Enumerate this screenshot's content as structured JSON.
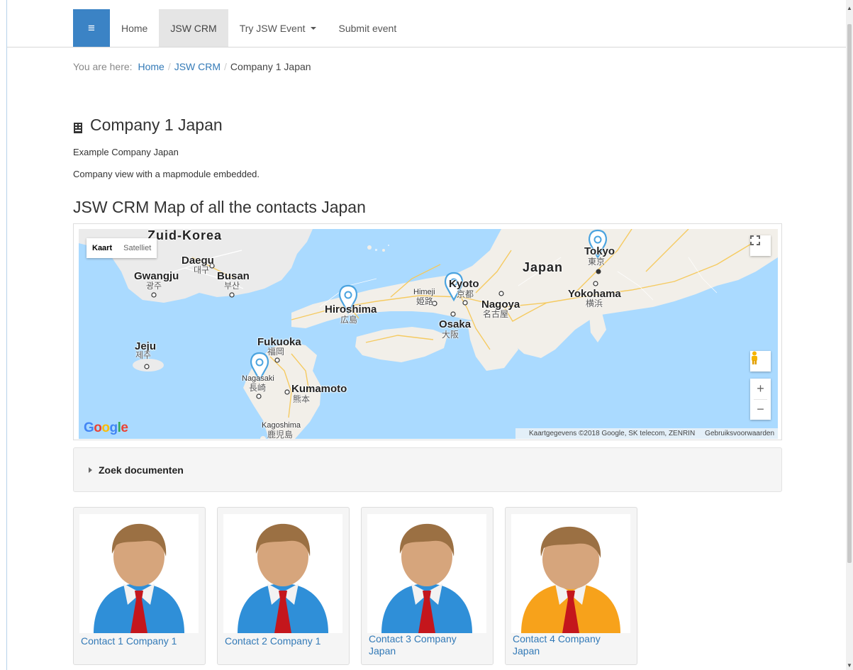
{
  "nav": {
    "menu_icon": "hamburger-icon",
    "items": [
      {
        "label": "Home"
      },
      {
        "label": "JSW CRM"
      },
      {
        "label": "Try JSW Event"
      },
      {
        "label": "Submit event"
      }
    ],
    "active_index": 1
  },
  "breadcrumb": {
    "prefix": "You are here:",
    "items": [
      "Home",
      "JSW CRM"
    ],
    "current": "Company 1 Japan"
  },
  "page": {
    "title": "Company 1 Japan",
    "title_icon": "building-icon",
    "description": "Example Company Japan",
    "subtext": "Company view with a mapmodule embedded.",
    "map_heading": "JSW CRM Map of all the contacts Japan"
  },
  "map": {
    "type_buttons": [
      "Kaart",
      "Satelliet"
    ],
    "active_type": "Kaart",
    "labels": {
      "zuid_korea": "Zuid-Korea",
      "japan": "Japan",
      "daegu": "Daegu",
      "daegu_native": "대구",
      "gwangju": "Gwangju",
      "gwangju_native": "광주",
      "busan": "Busan",
      "busan_native": "부산",
      "jeju": "Jeju",
      "jeju_native": "제주",
      "fukuoka": "Fukuoka",
      "fukuoka_native": "福岡",
      "nagasaki": "Nagasaki",
      "nagasaki_native": "長崎",
      "kumamoto": "Kumamoto",
      "kumamoto_native": "熊本",
      "kagoshima": "Kagoshima",
      "kagoshima_native": "鹿児島",
      "hiroshima": "Hiroshima",
      "hiroshima_native": "広島",
      "himeji": "Himeji",
      "himeji_native": "姫路",
      "kyoto": "Kyoto",
      "kyoto_native": "京都",
      "osaka": "Osaka",
      "osaka_native": "大阪",
      "nagoya": "Nagoya",
      "nagoya_native": "名古屋",
      "tokyo": "Tokyo",
      "tokyo_native": "東京",
      "yokohama": "Yokohama",
      "yokohama_native": "横浜"
    },
    "google_logo": "Google",
    "attribution": "Kaartgegevens ©2018 Google, SK telecom, ZENRIN",
    "terms": "Gebruiksvoorwaarden",
    "controls": [
      "fullscreen-icon",
      "pegman-icon",
      "zoom-in-icon",
      "zoom-out-icon"
    ],
    "zoom_in": "+",
    "zoom_out": "−",
    "marker_color": "#4aa3df"
  },
  "documents": {
    "label": "Zoek documenten"
  },
  "contacts": [
    {
      "name": "Contact 1 Company 1",
      "shirt_color": "#2f8fd8"
    },
    {
      "name": "Contact 2 Company 1",
      "shirt_color": "#2f8fd8"
    },
    {
      "name": "Contact 3 Company Japan",
      "shirt_color": "#2f8fd8"
    },
    {
      "name": "Contact 4 Company Japan",
      "shirt_color": "#f7a21b"
    }
  ],
  "colors": {
    "brand": "#3b83c5",
    "link": "#337ab7",
    "water": "#aadaff",
    "land": "#f2efe9",
    "korea_land": "#ebebeb"
  }
}
